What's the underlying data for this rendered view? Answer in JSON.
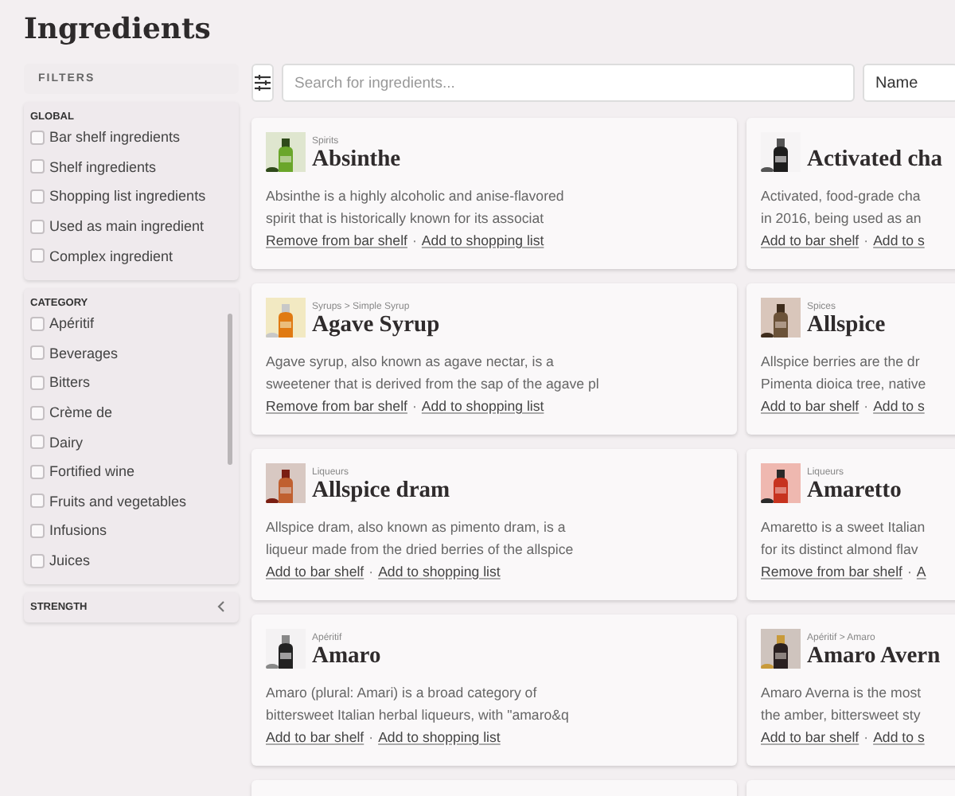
{
  "page_title": "Ingredients",
  "sidebar": {
    "header": "FILTERS",
    "groups": [
      {
        "title": "GLOBAL",
        "expanded": true,
        "scrollable": false,
        "options": [
          {
            "label": "Bar shelf ingredients",
            "checked": false
          },
          {
            "label": "Shelf ingredients",
            "checked": false
          },
          {
            "label": "Shopping list ingredients",
            "checked": false
          },
          {
            "label": "Used as main ingredient",
            "checked": false
          },
          {
            "label": "Complex ingredient",
            "checked": false
          }
        ]
      },
      {
        "title": "CATEGORY",
        "expanded": true,
        "scrollable": true,
        "options": [
          {
            "label": "Apéritif",
            "checked": false
          },
          {
            "label": "Beverages",
            "checked": false
          },
          {
            "label": "Bitters",
            "checked": false
          },
          {
            "label": "Crème de",
            "checked": false
          },
          {
            "label": "Dairy",
            "checked": false
          },
          {
            "label": "Fortified wine",
            "checked": false
          },
          {
            "label": "Fruits and vegetables",
            "checked": false
          },
          {
            "label": "Infusions",
            "checked": false
          },
          {
            "label": "Juices",
            "checked": false
          }
        ]
      },
      {
        "title": "STRENGTH",
        "expanded": false
      }
    ]
  },
  "toolbar": {
    "search": {
      "placeholder": "Search for ingredients..."
    },
    "sort": {
      "value": "Name"
    }
  },
  "cards": [
    {
      "category": "Spirits",
      "name": "Absinthe",
      "description": [
        "Absinthe is a highly alcoholic and anise-flavored",
        "spirit that is historically known for its associat"
      ],
      "actions": [
        "Remove from bar shelf",
        "Add to shopping list"
      ],
      "separator": "·"
    },
    {
      "name": "Activated cha",
      "description": [
        "Activated, food-grade cha",
        "in 2016, being used as an"
      ],
      "actions": [
        "Add to bar shelf",
        "Add to s"
      ],
      "separator": "·"
    },
    {
      "category": "Syrups > Simple Syrup",
      "name": "Agave Syrup",
      "description": [
        "Agave syrup, also known as agave nectar, is a",
        "sweetener that is derived from the sap of the agave pl"
      ],
      "actions": [
        "Remove from bar shelf",
        "Add to shopping list"
      ],
      "separator": "·"
    },
    {
      "category": "Spices",
      "name": "Allspice",
      "description": [
        "Allspice berries are the dr",
        "Pimenta dioica tree, native"
      ],
      "actions": [
        "Add to bar shelf",
        "Add to s"
      ],
      "separator": "·"
    },
    {
      "category": "Liqueurs",
      "name": "Allspice dram",
      "description": [
        "Allspice dram, also known as pimento dram, is a",
        "liqueur made from the dried berries of the allspice"
      ],
      "actions": [
        "Add to bar shelf",
        "Add to shopping list"
      ],
      "separator": "·"
    },
    {
      "category": "Liqueurs",
      "name": "Amaretto",
      "description": [
        "Amaretto is a sweet Italian",
        "for its distinct almond flav"
      ],
      "actions": [
        "Remove from bar shelf",
        "A"
      ],
      "separator": "·"
    },
    {
      "category": "Apéritif",
      "name": "Amaro",
      "description": [
        "Amaro (plural: Amari) is a broad category of",
        "bittersweet Italian herbal liqueurs, with \"amaro&q"
      ],
      "actions": [
        "Add to bar shelf",
        "Add to shopping list"
      ],
      "separator": "·"
    },
    {
      "category": "Apéritif > Amaro",
      "name": "Amaro Avern",
      "description": [
        "Amaro Averna is the most",
        "the amber, bittersweet sty"
      ],
      "actions": [
        "Add to bar shelf",
        "Add to s"
      ],
      "separator": "·"
    }
  ]
}
